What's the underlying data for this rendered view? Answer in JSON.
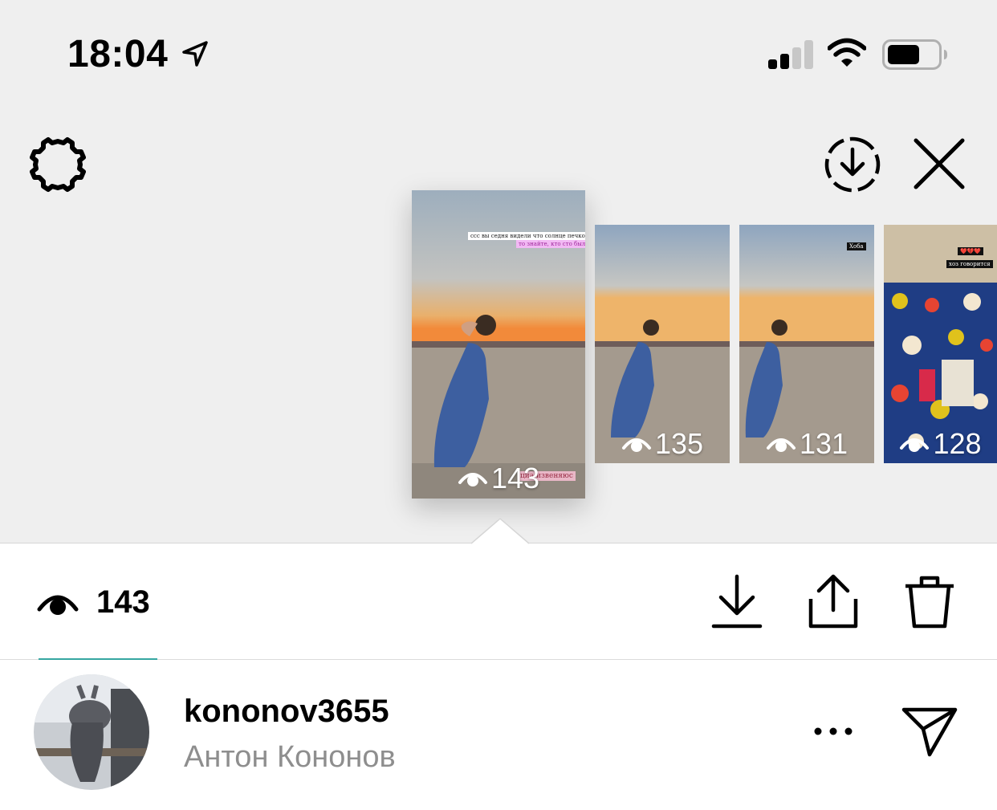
{
  "status_bar": {
    "time": "18:04",
    "battery_level": 0.65,
    "signal_bars": 2
  },
  "header": {
    "settings_icon": "gear-icon",
    "download_story_icon": "circle-download-icon",
    "close_icon": "close-icon"
  },
  "stories": [
    {
      "views": "143",
      "active": true,
      "overlay_lines": [
        "ccc вы седня видели что солнце печкоко",
        "то знайте, кто сто было я",
        "циа извеняюс"
      ]
    },
    {
      "views": "135",
      "active": false,
      "overlay_lines": []
    },
    {
      "views": "131",
      "active": false,
      "overlay_lines": [
        "Хоба"
      ]
    },
    {
      "views": "128",
      "active": false,
      "overlay_lines": [
        "❤️💔❤️",
        "хоз говорится"
      ]
    }
  ],
  "insights": {
    "views_icon": "eye-icon",
    "view_count": "143",
    "actions": [
      "download-icon",
      "share-icon",
      "trash-icon"
    ]
  },
  "viewers": [
    {
      "username": "kononov3655",
      "full_name": "Антон Кононов"
    }
  ],
  "colors": {
    "background": "#efefef",
    "tab_accent": "#36a6a1",
    "secondary_text": "#8e8e8e"
  }
}
